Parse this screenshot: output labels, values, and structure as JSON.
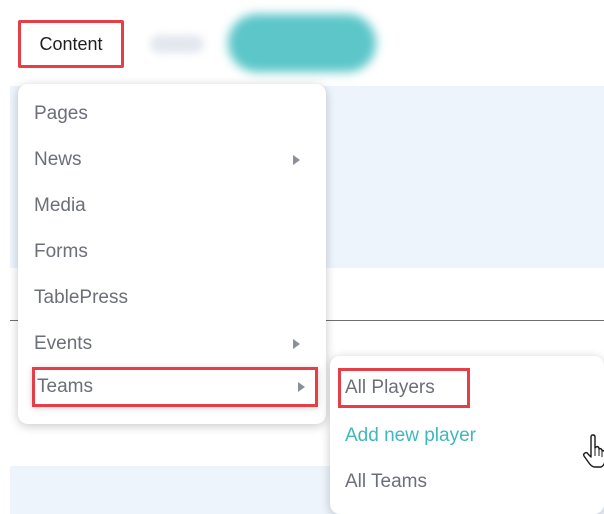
{
  "nav": {
    "content_label": "Content"
  },
  "content_menu": {
    "items": [
      {
        "label": "Pages",
        "has_submenu": false
      },
      {
        "label": "News",
        "has_submenu": true
      },
      {
        "label": "Media",
        "has_submenu": false
      },
      {
        "label": "Forms",
        "has_submenu": false
      },
      {
        "label": "TablePress",
        "has_submenu": false
      },
      {
        "label": "Events",
        "has_submenu": true
      },
      {
        "label": "Teams",
        "has_submenu": true
      }
    ]
  },
  "teams_submenu": {
    "items": [
      {
        "label": "All Players"
      },
      {
        "label": "Add new player"
      },
      {
        "label": "All Teams"
      }
    ]
  },
  "colors": {
    "highlight_box": "#e53e47",
    "hovered_link": "#3fb8bd",
    "menu_text": "#6b6f78"
  },
  "cursor": {
    "type": "hand-pointer"
  }
}
